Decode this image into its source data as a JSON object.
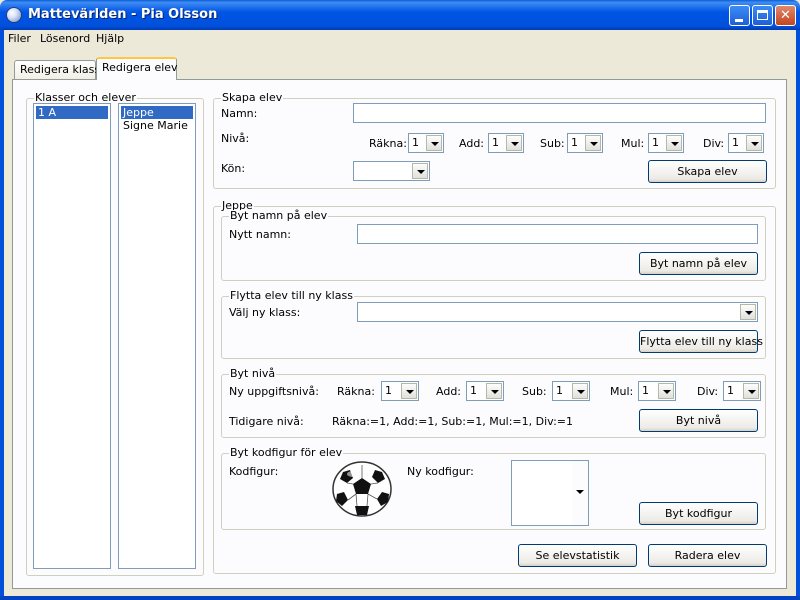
{
  "window": {
    "title": "Mattevärlden - Pia Olsson"
  },
  "menu": [
    "Filer",
    "Lösenord",
    "Hjälp"
  ],
  "tabs": [
    {
      "label": "Redigera klass",
      "active": false
    },
    {
      "label": "Redigera elev",
      "active": true
    }
  ],
  "classes_group": {
    "title": "Klasser och elever",
    "classes": [
      "1 A"
    ],
    "selected_class": "1 A",
    "students": [
      "Jeppe",
      "Signe Marie"
    ],
    "selected_student": "Jeppe"
  },
  "create": {
    "title": "Skapa elev",
    "name_label": "Namn:",
    "name_value": "",
    "level_label": "Nivå:",
    "gender_label": "Kön:",
    "gender_value": "",
    "levels": [
      {
        "label": "Räkna:",
        "value": "1"
      },
      {
        "label": "Add:",
        "value": "1"
      },
      {
        "label": "Sub:",
        "value": "1"
      },
      {
        "label": "Mul:",
        "value": "1"
      },
      {
        "label": "Div:",
        "value": "1"
      }
    ],
    "button": "Skapa elev"
  },
  "student": {
    "title": "Jeppe",
    "rename": {
      "title": "Byt namn på elev",
      "label": "Nytt namn:",
      "value": "",
      "button": "Byt namn på elev"
    },
    "move": {
      "title": "Flytta elev till ny klass",
      "label": "Välj ny klass:",
      "value": "",
      "button": "Flytta elev till ny klass"
    },
    "level": {
      "title": "Byt nivå",
      "new_label": "Ny uppgiftsnivå:",
      "levels": [
        {
          "label": "Räkna:",
          "value": "1"
        },
        {
          "label": "Add:",
          "value": "1"
        },
        {
          "label": "Sub:",
          "value": "1"
        },
        {
          "label": "Mul:",
          "value": "1"
        },
        {
          "label": "Div:",
          "value": "1"
        }
      ],
      "prev_label": "Tidigare nivå:",
      "prev_value": "Räkna:=1, Add:=1, Sub:=1, Mul:=1, Div:=1",
      "button": "Byt nivå"
    },
    "code": {
      "title": "Byt kodfigur för elev",
      "label": "Kodfigur:",
      "current_icon": "soccer-ball-icon",
      "new_label": "Ny kodfigur:",
      "button": "Byt kodfigur"
    }
  },
  "actions": {
    "stats": "Se elevstatistik",
    "delete": "Radera elev"
  },
  "colors": {
    "titlebar": "#0055e5",
    "selection": "#316ac5",
    "face": "#ece9d8",
    "panel": "#fcfcfe",
    "tab_highlight": "#ffc83c"
  }
}
